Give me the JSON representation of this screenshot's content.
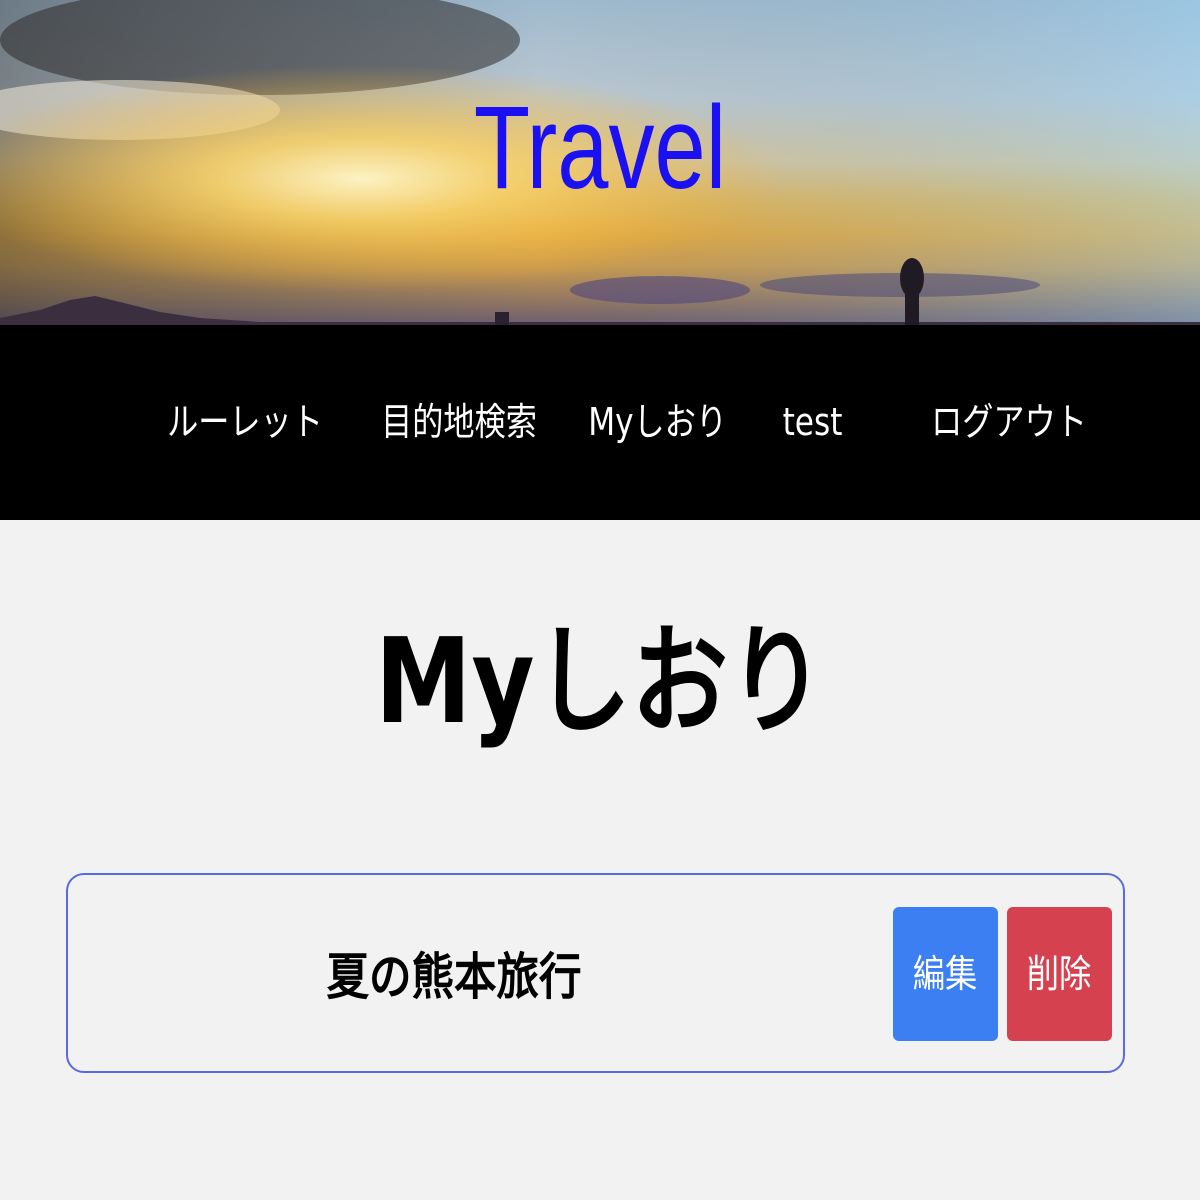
{
  "header": {
    "site_title": "Travel",
    "site_title_color": "#1a10f2",
    "background_image": "sunset-landscape"
  },
  "nav": {
    "items": [
      {
        "label": "ルーレット"
      },
      {
        "label": "目的地検索"
      },
      {
        "label": "Myしおり"
      },
      {
        "label": "test"
      },
      {
        "label": "ログアウト"
      }
    ]
  },
  "main": {
    "heading": "Myしおり",
    "cards": [
      {
        "title": "夏の熊本旅行",
        "edit_label": "編集",
        "delete_label": "削除"
      }
    ]
  },
  "colors": {
    "nav_background": "#000000",
    "page_background": "#f2f2f2",
    "card_border": "#5a6ae0",
    "edit_button": "#3b7ff2",
    "delete_button": "#d5414e"
  }
}
